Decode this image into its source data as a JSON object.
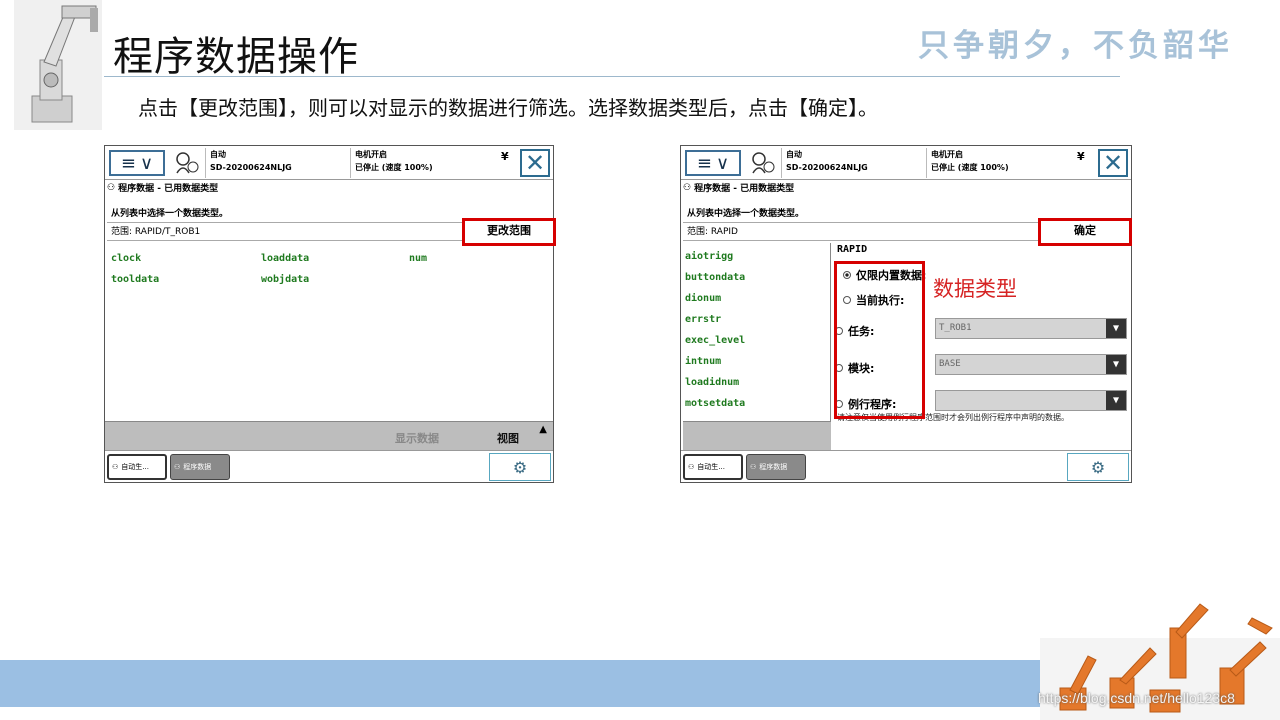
{
  "slide": {
    "title": "程序数据操作",
    "motto": "只争朝夕，不负韶华",
    "instruction": "点击【更改范围】，则可以对显示的数据进行筛选。选择数据类型后，点击【确定】。",
    "watermark": "https://blog.csdn.net/hello123c8"
  },
  "left_panel": {
    "status_mode": "自动",
    "status_id": "SD-20200624NLJG",
    "status_motor": "电机开启",
    "status_state": "已停止 (速度 100%)",
    "crumb": "程序数据 - 已用数据类型",
    "prompt": "从列表中选择一个数据类型。",
    "scope": "范围: RAPID/T_ROB1",
    "scope_button": "更改范围",
    "items": [
      "clock",
      "loaddata",
      "num",
      "tooldata",
      "wobjdata"
    ],
    "show_data": "显示数据",
    "view": "视图",
    "task1": "自动生...",
    "task2": "程序数据"
  },
  "right_panel": {
    "status_mode": "自动",
    "status_id": "SD-20200624NLJG",
    "status_motor": "电机开启",
    "status_state": "已停止 (速度 100%)",
    "crumb": "程序数据 - 已用数据类型",
    "prompt": "从列表中选择一个数据类型。",
    "scope": "范围: RAPID",
    "ok_button": "确定",
    "items": [
      "aiotrigg",
      "buttondata",
      "dionum",
      "errstr",
      "exec_level",
      "intnum",
      "loadidnum",
      "motsetdata"
    ],
    "rapid_heading": "RAPID",
    "opt_builtin": "仅限内置数据:",
    "opt_current": "当前执行:",
    "opt_task": "任务:",
    "opt_module": "模块:",
    "opt_routine": "例行程序:",
    "task_value": "T_ROB1",
    "module_value": "BASE",
    "routine_value": "",
    "note": "请注意仅当使用例行程序范围时才会列出例行程序中声明的数据。",
    "annotation": "数据类型",
    "task1": "自动生...",
    "task2": "程序数据"
  }
}
